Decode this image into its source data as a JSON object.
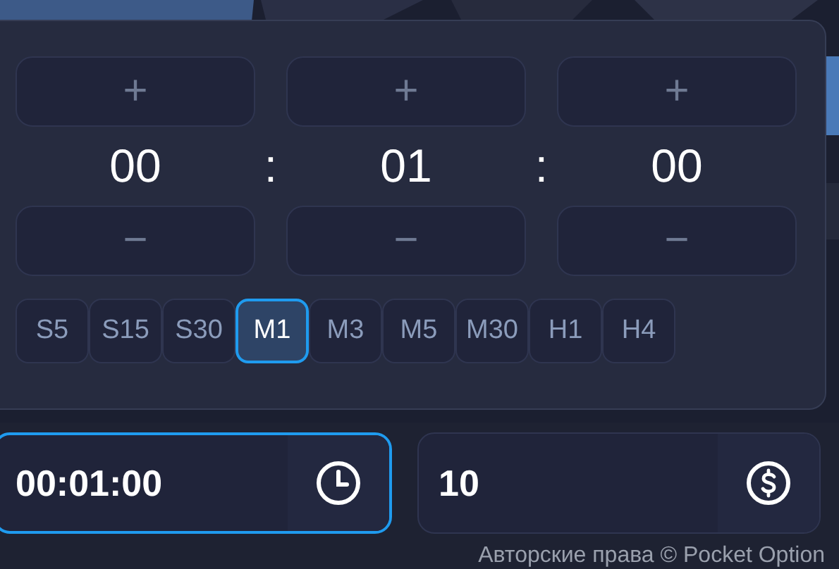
{
  "time_picker": {
    "units": [
      {
        "value": "00",
        "plus": "+",
        "minus": "−"
      },
      {
        "value": "01",
        "plus": "+",
        "minus": "−"
      },
      {
        "value": "00",
        "plus": "+",
        "minus": "−"
      }
    ],
    "separators": [
      ":",
      ":"
    ],
    "timeframes": [
      {
        "label": "S5",
        "selected": false
      },
      {
        "label": "S15",
        "selected": false
      },
      {
        "label": "S30",
        "selected": false
      },
      {
        "label": "M1",
        "selected": true
      },
      {
        "label": "M3",
        "selected": false
      },
      {
        "label": "M5",
        "selected": false
      },
      {
        "label": "M30",
        "selected": false
      },
      {
        "label": "H1",
        "selected": false
      },
      {
        "label": "H4",
        "selected": false
      }
    ]
  },
  "fields": [
    {
      "kind": "time",
      "value": "00:01:00",
      "focused": true
    },
    {
      "kind": "amount",
      "value": "10",
      "focused": false
    }
  ],
  "copyright": "Авторские права © Pocket Option"
}
